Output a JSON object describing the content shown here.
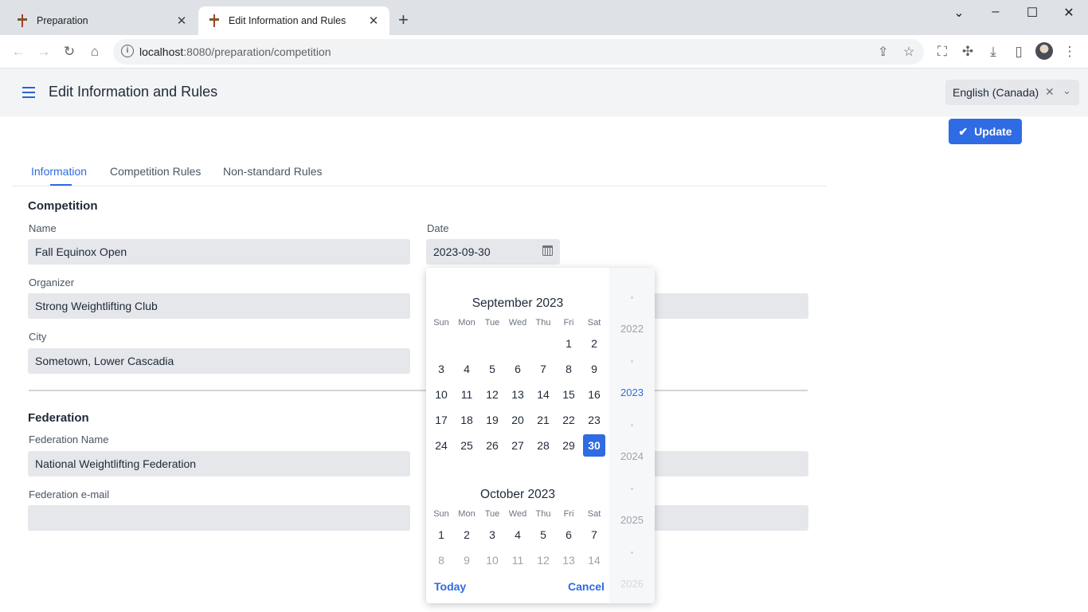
{
  "browser": {
    "tabs": [
      {
        "title": "Preparation"
      },
      {
        "title": "Edit Information and Rules"
      }
    ],
    "url_host": "localhost",
    "url_rest": ":8080/preparation/competition"
  },
  "app": {
    "title": "Edit Information and Rules",
    "language": "English (Canada)",
    "update_label": "Update"
  },
  "tabs": [
    "Information",
    "Competition Rules",
    "Non-standard Rules"
  ],
  "competition": {
    "heading": "Competition",
    "name_label": "Name",
    "name_value": "Fall Equinox Open",
    "date_label": "Date",
    "date_value": "2023-09-30",
    "organizer_label": "Organizer",
    "organizer_value": "Strong Weightlifting Club",
    "city_label": "City",
    "city_value": "Sometown, Lower Cascadia"
  },
  "federation": {
    "heading": "Federation",
    "name_label": "Federation Name",
    "name_value": "National Weightlifting Federation",
    "email_label": "Federation e-mail",
    "email_value": ""
  },
  "datepicker": {
    "weekdays": [
      "Sun",
      "Mon",
      "Tue",
      "Wed",
      "Thu",
      "Fri",
      "Sat"
    ],
    "months": [
      {
        "title": "September 2023",
        "weeks": [
          [
            "",
            "",
            "",
            "",
            "",
            "1",
            "2"
          ],
          [
            "3",
            "4",
            "5",
            "6",
            "7",
            "8",
            "9"
          ],
          [
            "10",
            "11",
            "12",
            "13",
            "14",
            "15",
            "16"
          ],
          [
            "17",
            "18",
            "19",
            "20",
            "21",
            "22",
            "23"
          ],
          [
            "24",
            "25",
            "26",
            "27",
            "28",
            "29",
            "30"
          ]
        ],
        "selected": "30"
      },
      {
        "title": "October 2023",
        "weeks": [
          [
            "1",
            "2",
            "3",
            "4",
            "5",
            "6",
            "7"
          ],
          [
            "8",
            "9",
            "10",
            "11",
            "12",
            "13",
            "14"
          ]
        ]
      }
    ],
    "years": [
      "2022",
      "2023",
      "2024",
      "2025",
      "2026"
    ],
    "current_year": "2023",
    "today_label": "Today",
    "cancel_label": "Cancel"
  },
  "colors": {
    "accent": "#2f6be3",
    "field_bg": "#e5e7eb",
    "appbar_bg": "#f3f4f6"
  }
}
